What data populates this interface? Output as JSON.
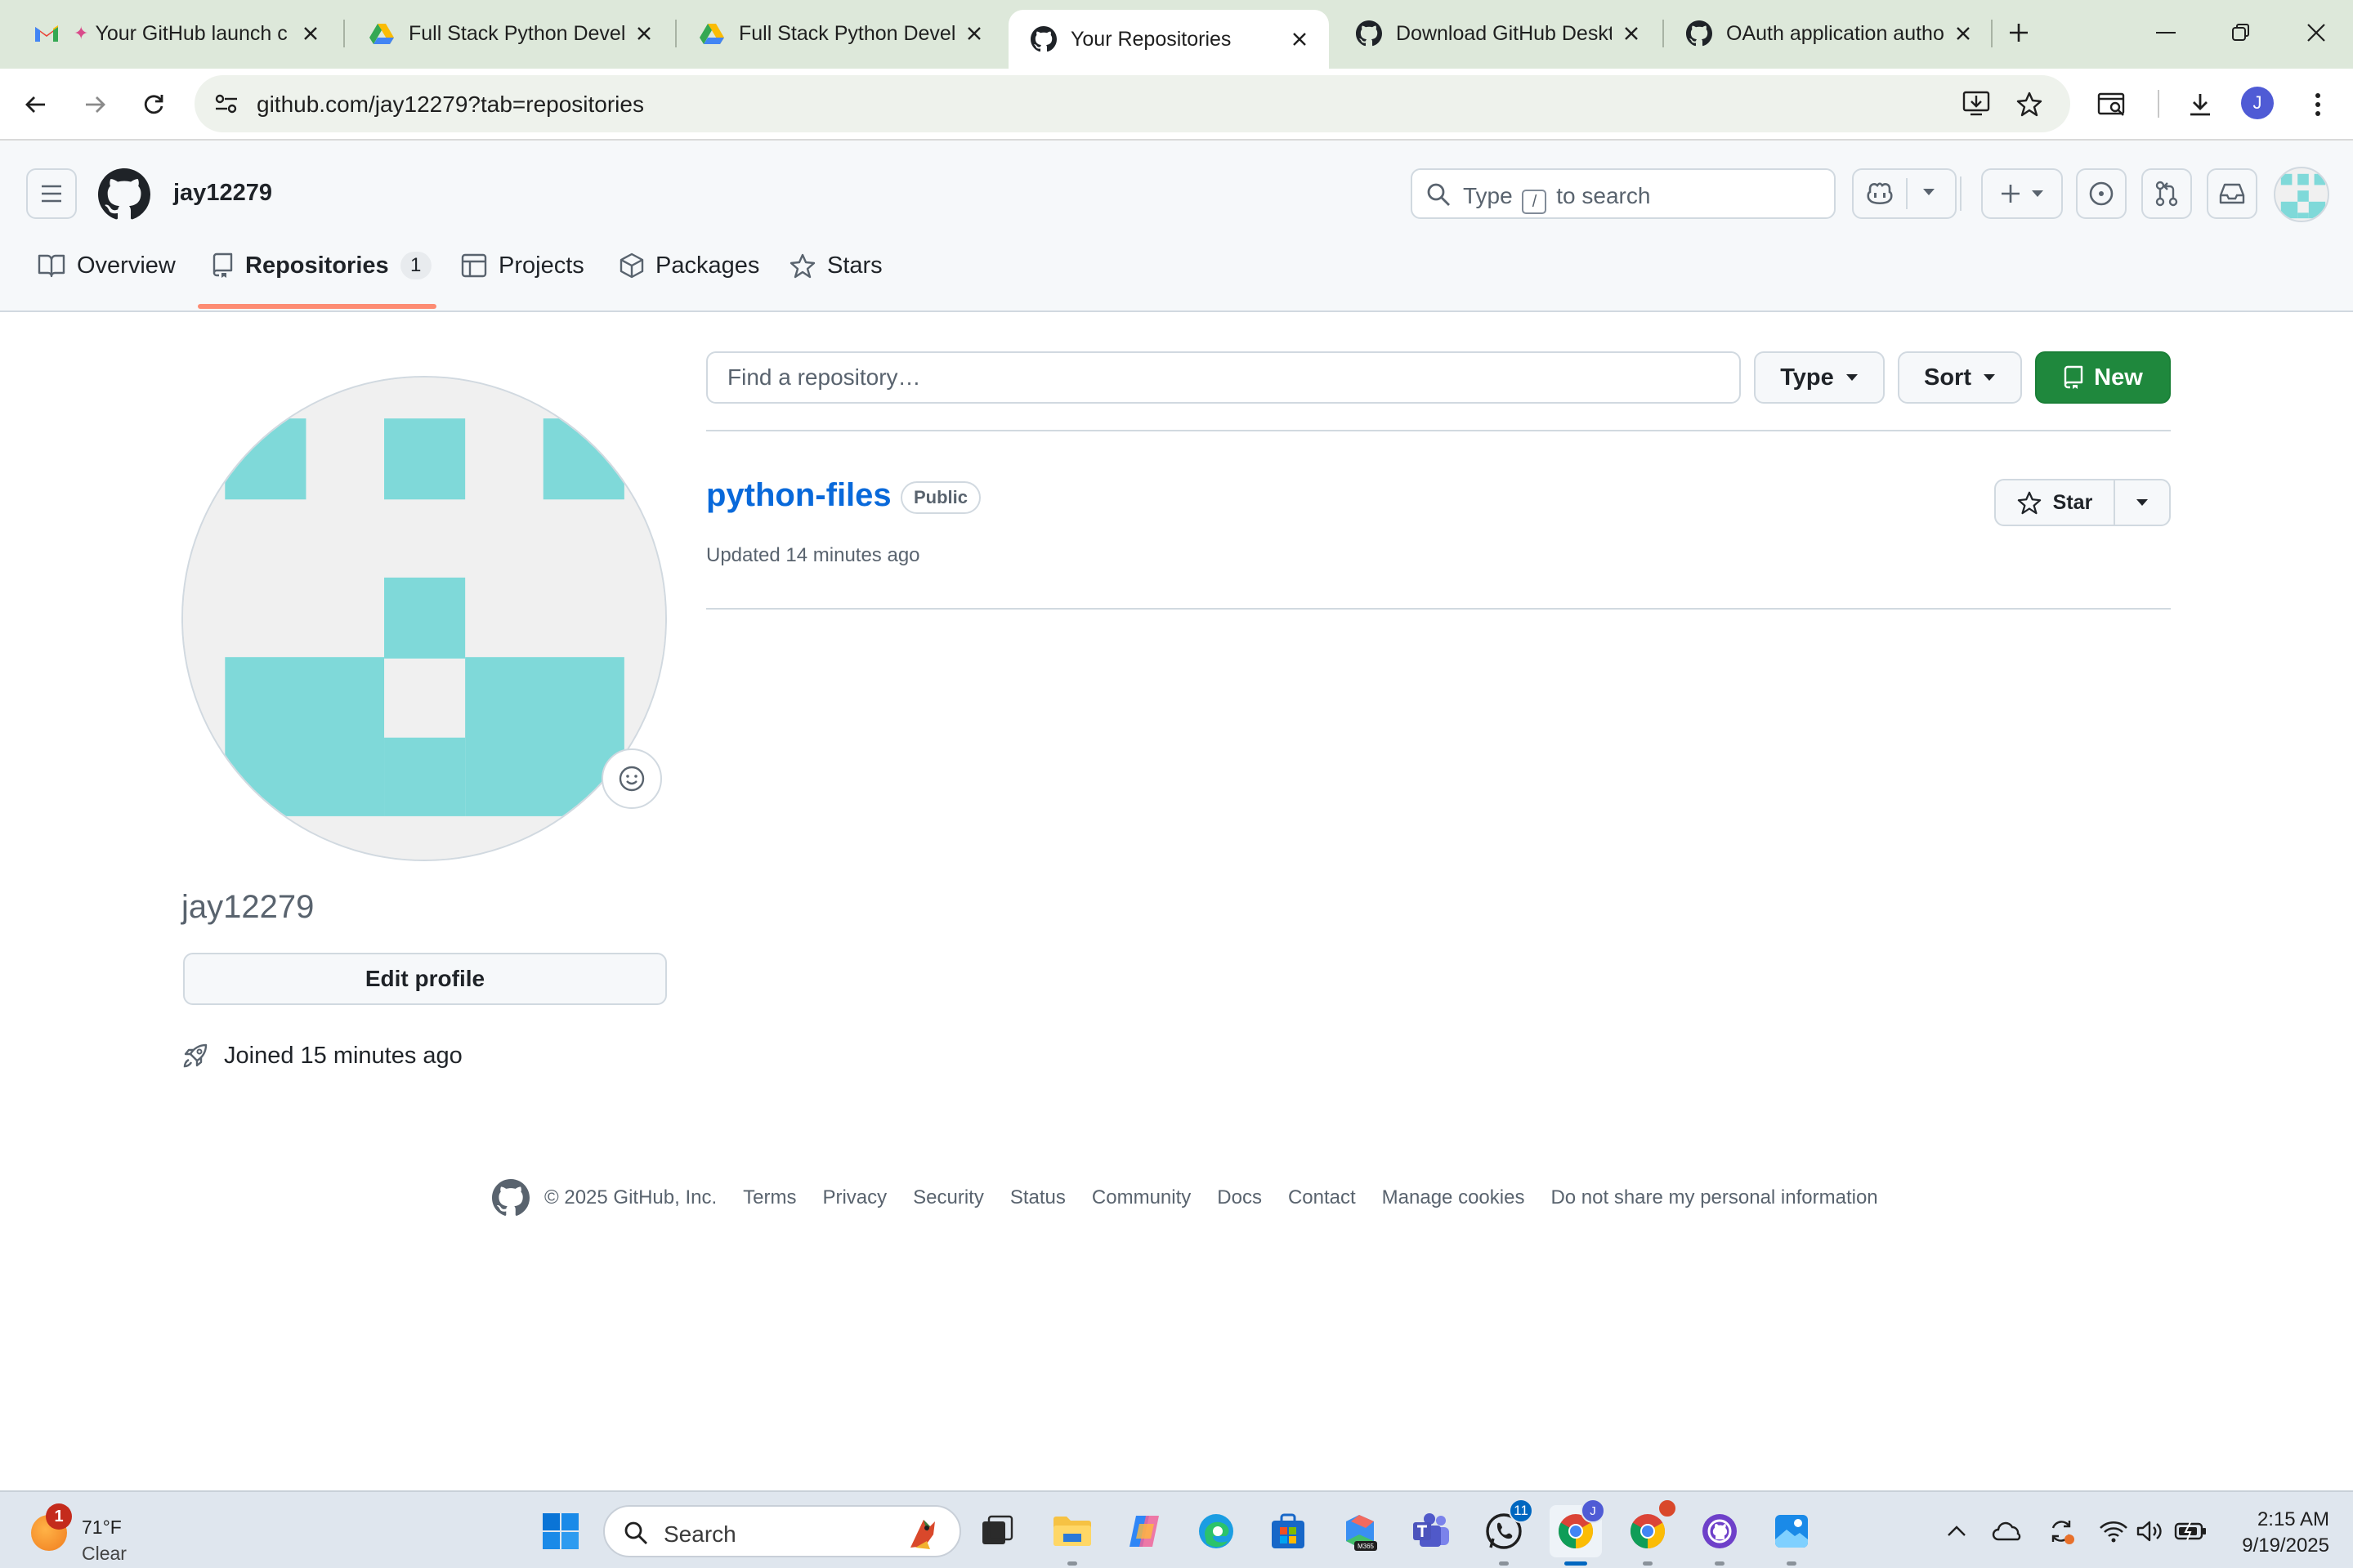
{
  "browser": {
    "tabs": [
      {
        "title": "Your GitHub launch c",
        "favicon": "gmail-icon",
        "active": false
      },
      {
        "title": "Full Stack Python Develo",
        "favicon": "google-drive-icon",
        "active": false
      },
      {
        "title": "Full Stack Python Develo",
        "favicon": "google-drive-icon",
        "active": false
      },
      {
        "title": "Your Repositories",
        "favicon": "github-icon",
        "active": true
      },
      {
        "title": "Download GitHub Deskt",
        "favicon": "github-icon",
        "active": false
      },
      {
        "title": "OAuth application autho",
        "favicon": "github-icon",
        "active": false
      }
    ],
    "url": "github.com/jay12279?tab=repositories",
    "profile_initial": "J"
  },
  "github": {
    "username": "jay12279",
    "search_prefix": "Type",
    "search_key": "/",
    "search_suffix": "to search",
    "nav": {
      "overview": "Overview",
      "repositories": "Repositories",
      "repositories_count": "1",
      "projects": "Projects",
      "packages": "Packages",
      "stars": "Stars"
    },
    "profile": {
      "login": "jay12279",
      "edit_label": "Edit profile",
      "joined": "Joined 15 minutes ago"
    },
    "repo_toolbar": {
      "filter_placeholder": "Find a repository…",
      "type_label": "Type",
      "sort_label": "Sort",
      "new_label": "New"
    },
    "repositories": [
      {
        "name": "python-files",
        "visibility": "Public",
        "updated": "Updated 14 minutes ago",
        "star_label": "Star"
      }
    ],
    "footer": {
      "copyright": "© 2025 GitHub, Inc.",
      "links": [
        "Terms",
        "Privacy",
        "Security",
        "Status",
        "Community",
        "Docs",
        "Contact",
        "Manage cookies",
        "Do not share my personal information"
      ]
    }
  },
  "taskbar": {
    "weather_temp": "71°F",
    "weather_condition": "Clear",
    "weather_badge": "1",
    "search_label": "Search",
    "whatsapp_badge": "11",
    "time": "2:15 AM",
    "date": "9/19/2025"
  },
  "colors": {
    "accent_link": "#0969da",
    "new_button": "#1f883d",
    "tab_underline": "#fd8c73",
    "identicon": "#7fd9d9"
  }
}
